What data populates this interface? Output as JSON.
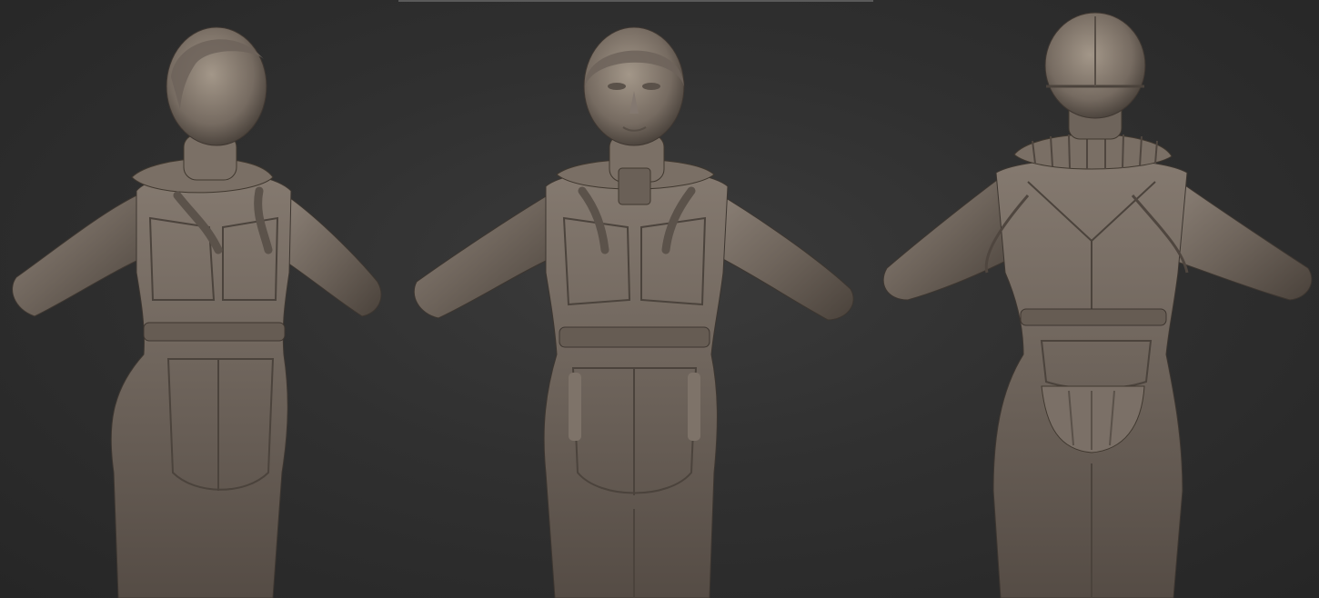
{
  "scene": {
    "background_color": "#2e2e2e",
    "material_color": "#6f655c",
    "material_highlight": "#9a8f84",
    "material_shadow": "#3f3832",
    "views": [
      {
        "id": "three-quarter",
        "kind": "three-quarter-front"
      },
      {
        "id": "front",
        "kind": "front"
      },
      {
        "id": "back",
        "kind": "back"
      }
    ]
  }
}
